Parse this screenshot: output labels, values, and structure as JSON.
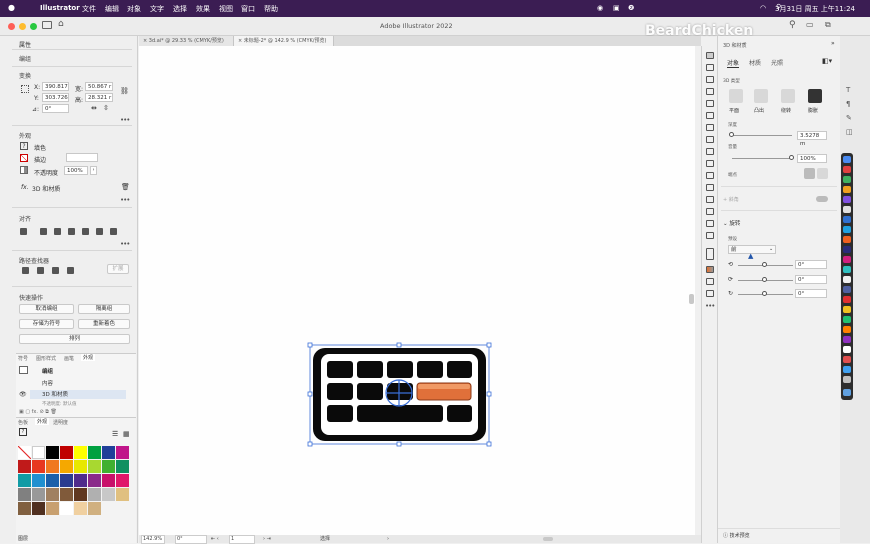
{
  "menubar": {
    "app": "Illustrator",
    "items": [
      "文件",
      "编辑",
      "对象",
      "文字",
      "选择",
      "效果",
      "视图",
      "窗口",
      "帮助"
    ],
    "clock": "3月31日 周五 上午11:24"
  },
  "window": {
    "title": "Adobe Illustrator 2022",
    "watermark": "BeardChicken"
  },
  "doc_tabs": [
    "3d.ai* @ 29.33 % (CMYK/预览)",
    "未标题-2* @ 142.9 % (CMYK/预览)"
  ],
  "properties": {
    "tab": "属性",
    "group_label": "编组",
    "transform": {
      "title": "变换",
      "x_label": "X:",
      "x": "390.817",
      "y_label": "Y:",
      "y": "303.726",
      "w_label": "宽:",
      "w": "50.867 r",
      "h_label": "高:",
      "h": "28.321 r",
      "angle_label": "⊿:",
      "angle": "0°"
    },
    "appearance": {
      "title": "外观",
      "fill": "填色",
      "stroke": "描边",
      "opacity_label": "不透明度",
      "opacity": "100%",
      "fx_label": "fx.",
      "effect": "3D 和材质"
    },
    "align": {
      "title": "对齐"
    },
    "pathfinder": {
      "title": "路径查找器",
      "expand": "扩展"
    },
    "quick": {
      "title": "快速操作",
      "buttons": [
        "取消编组",
        "隔离组",
        "存储为符号",
        "重新着色",
        "排列"
      ]
    }
  },
  "layers_panel": {
    "tabs": [
      "符号",
      "图形样式",
      "画笔",
      "外观"
    ],
    "rows": [
      "编组",
      "内容",
      "3D 和材质"
    ],
    "row4": "不透明度: 默认值"
  },
  "swatch_panel": {
    "tabs": [
      "色板",
      "外观",
      "透明度"
    ],
    "footer": "图层"
  },
  "swatch_colors": [
    "#000000",
    "#c00000",
    "#ffff00",
    "#00a040",
    "#1f3f99",
    "#c0158a",
    "#c01a1a",
    "#e83820",
    "#f07820",
    "#f5a800",
    "#e8e800",
    "#a8d830",
    "#40b030",
    "#109060",
    "#109ba5",
    "#2090d0",
    "#1a5faa",
    "#2a3c90",
    "#502c8c",
    "#8a2a8a",
    "#c8106a",
    "#e0186a",
    "#808080",
    "#999999",
    "#a08060",
    "#805a3a",
    "#603820",
    "#b0b0b0",
    "#c8c8c8",
    "#e0c080",
    "#806040",
    "#503020",
    "#c8a070",
    "#ffffff",
    "#f0d0a0",
    "#d0b080"
  ],
  "statusbar": {
    "zoom": "142.9%",
    "rotate": "0°",
    "page": "1",
    "mode": "选择"
  },
  "panel3d": {
    "title": "3D 和材质",
    "tabs": [
      "对象",
      "材质",
      "光照"
    ],
    "section_type": "3D 类型",
    "types": [
      "平面",
      "凸出",
      "绕转",
      "膨胀"
    ],
    "depth_label": "深度",
    "depth": "3.5278 m",
    "volume_label": "音量",
    "volume": "100%",
    "twist_label": "端点",
    "bevel_label": "斜角",
    "rotation_label": "旋转",
    "preset_label": "预设",
    "preset": "前",
    "rot": [
      "0°",
      "0°",
      "0°"
    ],
    "tech_preview": "技术预览"
  }
}
